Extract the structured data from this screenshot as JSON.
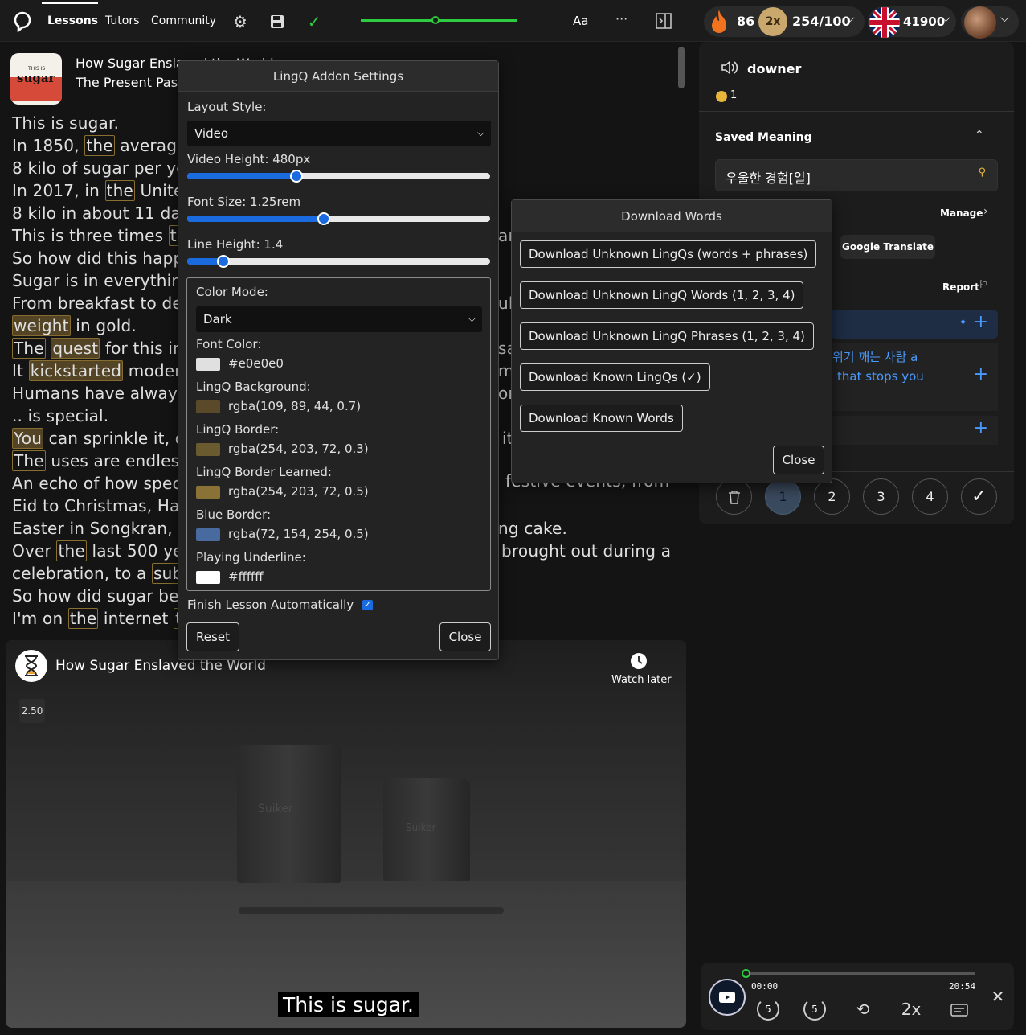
{
  "nav": {
    "tabs": [
      "Lessons",
      "Tutors",
      "Community"
    ],
    "progress_fraction": 0.48,
    "font_label": "Aa",
    "more_label": "···",
    "streak": "86",
    "multiplier": "2x",
    "coins": "254/100",
    "lingqs": "41900"
  },
  "lesson": {
    "title": "How Sugar Enslaved the World",
    "course": "The Present Past",
    "thumb_word": "sugar",
    "thumb_small": "THIS IS"
  },
  "reader_lines": {
    "l1": "This is sugar.",
    "l2a": "In 1850, ",
    "l2b": "the",
    "l2c": " average",
    "l3": "8 kilo of sugar per yea",
    "l4a": "In 2017, in ",
    "l4b": "the",
    "l4c": " United",
    "l5": "8 kilo in about 11 day",
    "l6a": "This is three times ",
    "l6b": "the",
    "l7": "So how did this happe",
    "l8": "Sugar is in everything",
    "l9": "From breakfast to des",
    "l10a": "weight",
    "l10b": " in gold.",
    "l11a": "The",
    "l11b": "quest",
    "l11c": " for this inn",
    "l12a": "It ",
    "l12b": "kickstarted",
    "l12c": " modern",
    "l13": "Humans have always",
    "l14": ".. is special.",
    "l15a": "You",
    "l15b": " can sprinkle it, di",
    "l16a": "The",
    "l16b": " uses are endless,",
    "l17": "An echo of how speci",
    "l18": "Eid to Christmas, Han",
    "l19": "Easter in Songkran, M",
    "l20a": "Over ",
    "l20b": "the",
    "l20c": " last 500 yea",
    "l21a": "celebration, to a ",
    "l21b": "subs",
    "l22": "So how did sugar bec",
    "l23a": "I'm on ",
    "l23b": "the",
    "l23c": " internet ",
    "l23d": "th",
    "r6": "ar",
    "r9": "ul",
    "r11": "sa",
    "r12": "m",
    "r13": "or",
    "r15": "it",
    "r17": "festive events, from",
    "r19": "ng cake.",
    "r20": "brought out during a"
  },
  "settings": {
    "title": "LingQ Addon Settings",
    "layout_label": "Layout Style:",
    "layout_value": "Video",
    "video_height_label": "Video Height: 480px",
    "video_height_fraction": 0.36,
    "font_size_label": "Font Size: 1.25rem",
    "font_size_fraction": 0.45,
    "line_height_label": "Line Height: 1.4",
    "line_height_fraction": 0.12,
    "color_mode_label": "Color Mode:",
    "color_mode_value": "Dark",
    "font_color_label": "Font Color:",
    "font_color_value": "#e0e0e0",
    "lingq_bg_label": "LingQ Background:",
    "lingq_bg_value": "rgba(109, 89, 44, 0.7)",
    "lingq_border_label": "LingQ Border:",
    "lingq_border_value": "rgba(254, 203, 72, 0.3)",
    "lingq_border_learned_label": "LingQ Border Learned:",
    "lingq_border_learned_value": "rgba(254, 203, 72, 0.5)",
    "blue_border_label": "Blue Border:",
    "blue_border_value": "rgba(72, 154, 254, 0.5)",
    "underline_label": "Playing Underline:",
    "underline_value": "#ffffff",
    "finish_label": "Finish Lesson Automatically",
    "finish_checked": true,
    "reset_label": "Reset",
    "close_label": "Close"
  },
  "download": {
    "title": "Download Words",
    "buttons": [
      "Download Unknown LingQs (words + phrases)",
      "Download Unknown LingQ Words (1, 2, 3, 4)",
      "Download Unknown LingQ Phrases (1, 2, 3, 4)",
      "Download Known LingQs (✓)",
      "Download Known Words"
    ],
    "close_label": "Close"
  },
  "side": {
    "word": "downer",
    "coin_count": "1",
    "saved_meaning_label": "Saved Meaning",
    "meaning_value": "우울한 경험[일]",
    "manage_label": "Manage",
    "google_label": "Google Translate",
    "report_label": "Report",
    "hint1": "위기 깨는 사람 a",
    "hint2": "that stops you",
    "levels": [
      "1",
      "2",
      "3",
      "4"
    ]
  },
  "video": {
    "title": "How Sugar Enslaved the World",
    "watch_later": "Watch later",
    "speed": "2.50",
    "caption": "This is sugar.",
    "bag_text_1": "Suiker",
    "bag_text_2": "Suiker"
  },
  "player": {
    "time_current": "00:00",
    "time_total": "20:54",
    "rewind": "5",
    "forward": "5",
    "speed_label": "2x"
  },
  "colors": {
    "accent_blue": "#1a6ae0",
    "progress_green": "#2ecc40",
    "lingq_bg": "rgba(109,89,44,0.7)",
    "swatch_font": "#e0e0e0",
    "swatch_blue": "#486a9e",
    "swatch_gold": "#8a7236"
  }
}
